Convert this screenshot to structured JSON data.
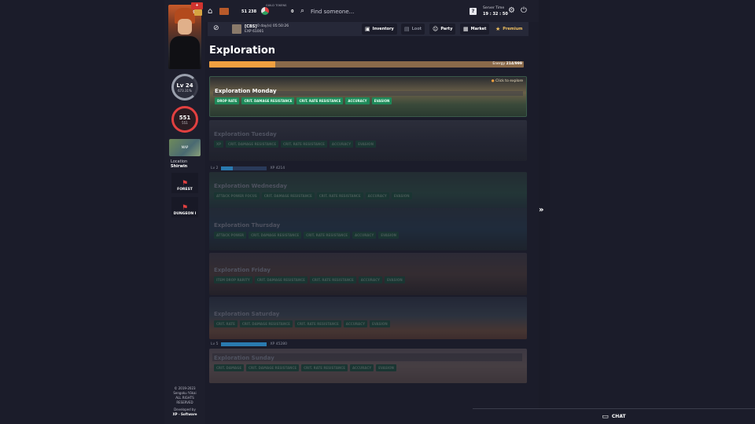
{
  "colors": {
    "accent": "#f0a040",
    "tag_green": "#1f8a5a",
    "hp_red": "#e24040",
    "bg": "#1b1c2a"
  },
  "player": {
    "badge": "+ 999",
    "level": "Lv 24",
    "level_pct": "673.31%",
    "hp": "551",
    "hp_max": "551",
    "location_label": "Location",
    "location": "Shirwin",
    "map_label": "MAP",
    "zones": [
      "FOREST",
      "DUNGEON I"
    ]
  },
  "footer": {
    "copyright": "© 2019-2023",
    "company": "Sengoku Yōkai",
    "rights": "ALL RIGHTS RESERVED",
    "dev_label": "Developed by",
    "dev": "XP - Software"
  },
  "topbar": {
    "ryo": "51 238",
    "guild_label": "GUILD TOKENS",
    "guild_tokens": "0",
    "search_placeholder": "Find someone...",
    "server_time_label": "Server Time",
    "server_time": "19 : 32 : 50"
  },
  "subbar": {
    "player_name": "[CBS]",
    "player_tag": "0 day(s) 05:50:26",
    "xp": "EXP 61001",
    "buttons": [
      "Inventory",
      "Loot",
      "Party",
      "Market",
      "Premium"
    ]
  },
  "page": {
    "title": "Exploration",
    "energy_label": "Energy",
    "energy_value": "214/999",
    "energy_fraction": 0.21,
    "click_hint": "Click to explore"
  },
  "explorations": [
    {
      "title": "Exploration Monday",
      "tags": [
        "DROP RATE",
        "CRIT. DAMAGE RESISTANCE",
        "CRIT. RATE RESISTANCE",
        "ACCURACY",
        "EVASION"
      ],
      "active": true
    },
    {
      "title": "Exploration Tuesday",
      "tags": [
        "XP",
        "CRIT. DAMAGE RESISTANCE",
        "CRIT. RATE RESISTANCE",
        "ACCURACY",
        "EVASION"
      ],
      "active": false
    },
    {
      "title": "Exploration Wednesday",
      "tags": [
        "ATTACK POWER FOCUS",
        "CRIT. DAMAGE RESISTANCE",
        "CRIT. RATE RESISTANCE",
        "ACCURACY",
        "EVASION"
      ],
      "active": false
    },
    {
      "title": "Exploration Thursday",
      "tags": [
        "ATTACK POWER",
        "CRIT. DAMAGE RESISTANCE",
        "CRIT. RATE RESISTANCE",
        "ACCURACY",
        "EVASION"
      ],
      "active": false
    },
    {
      "title": "Exploration Friday",
      "tags": [
        "ITEM DROP RARITY",
        "CRIT. DAMAGE RESISTANCE",
        "CRIT. RATE RESISTANCE",
        "ACCURACY",
        "EVASION"
      ],
      "active": false
    },
    {
      "title": "Exploration Saturday",
      "tags": [
        "CRIT. RATE",
        "CRIT. DAMAGE RESISTANCE",
        "CRIT. RATE RESISTANCE",
        "ACCURACY",
        "EVASION"
      ],
      "active": false
    },
    {
      "title": "Exploration Sunday",
      "tags": [
        "CRIT. DAMAGE",
        "CRIT. DAMAGE RESISTANCE",
        "CRIT. RATE RESISTANCE",
        "ACCURACY",
        "EVASION"
      ],
      "active": false
    }
  ],
  "level_reqs": [
    {
      "level": "Lv 2",
      "xp": "XP 4214"
    },
    {
      "level": "Lv 5",
      "xp": "XP 45280"
    }
  ],
  "chat_label": "CHAT"
}
